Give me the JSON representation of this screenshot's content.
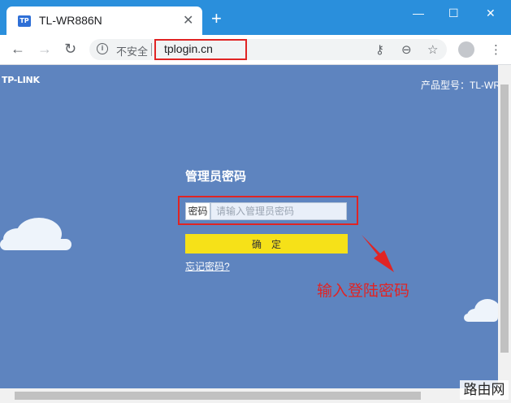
{
  "browser": {
    "tab_title": "TL-WR886N",
    "tab_close": "✕",
    "new_tab": "+",
    "favicon_text": "TP",
    "security_label": "不安全",
    "url": "tplogin.cn",
    "minimize": "—",
    "maximize": "☐",
    "close": "✕"
  },
  "page": {
    "logo": "TP-LINK",
    "model": "产品型号：TL-WR",
    "form_title": "管理员密码",
    "password_label": "密码",
    "password_placeholder": "请输入管理员密码",
    "confirm_button": "确定",
    "forgot_link": "忘记密码?"
  },
  "annotation": {
    "text": "输入登陆密码"
  },
  "watermark": "路由网",
  "colors": {
    "accent": "#2a8fdc",
    "page_bg": "#5e84bf",
    "button": "#f6e118",
    "annotation": "#e02424"
  }
}
